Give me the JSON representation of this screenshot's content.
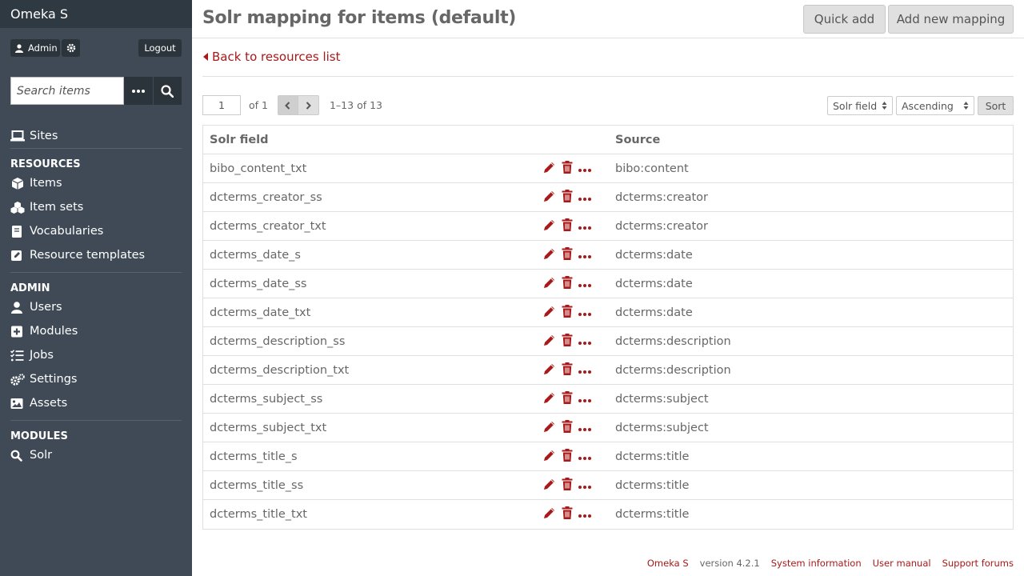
{
  "app": {
    "brand": "Omeka S"
  },
  "user": {
    "name": "Admin",
    "logout_label": "Logout"
  },
  "search": {
    "placeholder": "Search items"
  },
  "nav": {
    "top": [
      {
        "key": "sites",
        "label": "Sites",
        "icon": "laptop-icon"
      }
    ],
    "sections": [
      {
        "header": "RESOURCES",
        "items": [
          {
            "key": "items",
            "label": "Items",
            "icon": "cube-icon"
          },
          {
            "key": "item-sets",
            "label": "Item sets",
            "icon": "cubes-icon"
          },
          {
            "key": "vocabularies",
            "label": "Vocabularies",
            "icon": "book-icon"
          },
          {
            "key": "resource-templates",
            "label": "Resource templates",
            "icon": "edit-square-icon"
          }
        ]
      },
      {
        "header": "ADMIN",
        "items": [
          {
            "key": "users",
            "label": "Users",
            "icon": "user-icon"
          },
          {
            "key": "modules",
            "label": "Modules",
            "icon": "plus-square-icon"
          },
          {
            "key": "jobs",
            "label": "Jobs",
            "icon": "tasks-icon"
          },
          {
            "key": "settings",
            "label": "Settings",
            "icon": "cogs-icon"
          },
          {
            "key": "assets",
            "label": "Assets",
            "icon": "image-icon"
          }
        ]
      },
      {
        "header": "MODULES",
        "items": [
          {
            "key": "solr",
            "label": "Solr",
            "icon": "search-icon"
          }
        ]
      }
    ]
  },
  "header": {
    "title": "Solr mapping for items (default)",
    "quick_add_label": "Quick add",
    "add_mapping_label": "Add new mapping"
  },
  "back_link": {
    "label": "Back to resources list"
  },
  "pagination": {
    "page": "1",
    "of_label": "of 1",
    "range": "1–13 of 13"
  },
  "sorting": {
    "field": "Solr field",
    "order": "Ascending",
    "sort_label": "Sort"
  },
  "table": {
    "headers": {
      "field": "Solr field",
      "source": "Source"
    },
    "rows": [
      {
        "field": "bibo_content_txt",
        "source": "bibo:content"
      },
      {
        "field": "dcterms_creator_ss",
        "source": "dcterms:creator"
      },
      {
        "field": "dcterms_creator_txt",
        "source": "dcterms:creator"
      },
      {
        "field": "dcterms_date_s",
        "source": "dcterms:date"
      },
      {
        "field": "dcterms_date_ss",
        "source": "dcterms:date"
      },
      {
        "field": "dcterms_date_txt",
        "source": "dcterms:date"
      },
      {
        "field": "dcterms_description_ss",
        "source": "dcterms:description"
      },
      {
        "field": "dcterms_description_txt",
        "source": "dcterms:description"
      },
      {
        "field": "dcterms_subject_ss",
        "source": "dcterms:subject"
      },
      {
        "field": "dcterms_subject_txt",
        "source": "dcterms:subject"
      },
      {
        "field": "dcterms_title_s",
        "source": "dcterms:title"
      },
      {
        "field": "dcterms_title_ss",
        "source": "dcterms:title"
      },
      {
        "field": "dcterms_title_txt",
        "source": "dcterms:title"
      }
    ]
  },
  "footer": {
    "brand": "Omeka S",
    "version": "version 4.2.1",
    "system_info": "System information",
    "user_manual": "User manual",
    "support": "Support forums"
  },
  "colors": {
    "sidebar": "#3f4a56",
    "brand_bar": "#2f3942",
    "accent": "#a91919",
    "text": "#676767"
  }
}
